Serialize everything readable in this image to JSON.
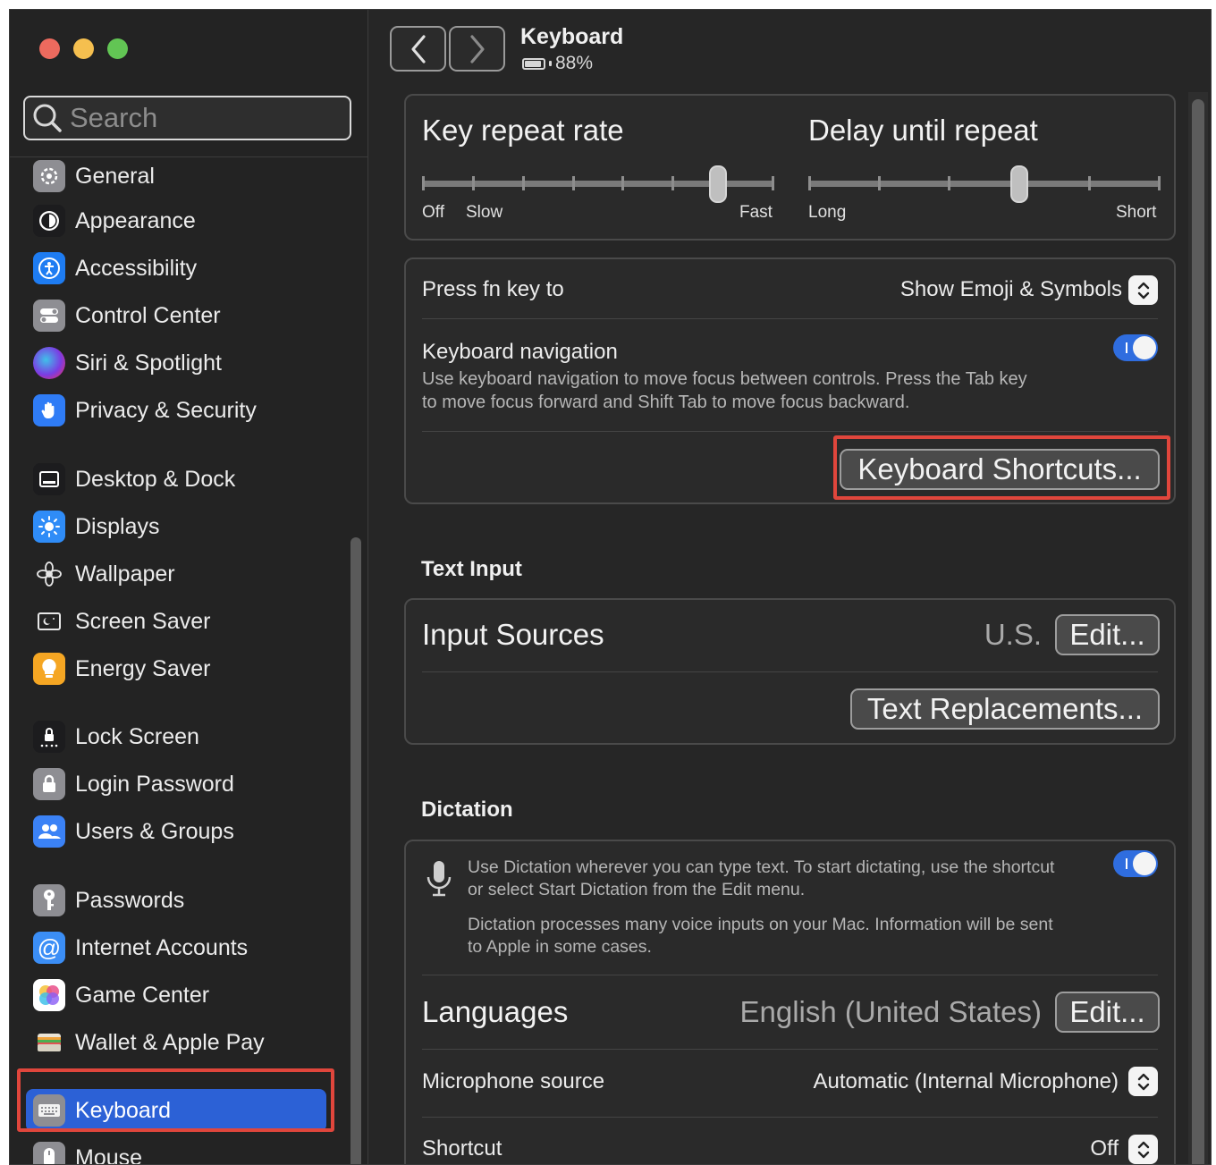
{
  "window": {
    "title": "Keyboard",
    "battery_percent": "88%",
    "battery_level": 0.88
  },
  "search": {
    "placeholder": "Search"
  },
  "sidebar": {
    "items": [
      {
        "label": "General",
        "icon": "gear-icon",
        "color": "#8e8e93"
      },
      {
        "label": "Appearance",
        "icon": "appearance-icon",
        "color": "#1c1c1e"
      },
      {
        "label": "Accessibility",
        "icon": "accessibility-icon",
        "color": "#1e7cf2"
      },
      {
        "label": "Control Center",
        "icon": "control-center-icon",
        "color": "#8e8e93"
      },
      {
        "label": "Siri & Spotlight",
        "icon": "siri-icon",
        "color": "#6c3ce0"
      },
      {
        "label": "Privacy & Security",
        "icon": "hand-icon",
        "color": "#2f7cf6"
      },
      {
        "label": "Desktop & Dock",
        "icon": "dock-icon",
        "color": "#1c1c1e"
      },
      {
        "label": "Displays",
        "icon": "sun-icon",
        "color": "#2f8cf7"
      },
      {
        "label": "Wallpaper",
        "icon": "flower-icon",
        "color": "#232323"
      },
      {
        "label": "Screen Saver",
        "icon": "screen-saver-icon",
        "color": "#232323"
      },
      {
        "label": "Energy Saver",
        "icon": "lightbulb-icon",
        "color": "#f5a623"
      },
      {
        "label": "Lock Screen",
        "icon": "lock-screen-icon",
        "color": "#1c1c1e"
      },
      {
        "label": "Login Password",
        "icon": "lock-icon",
        "color": "#8e8e93"
      },
      {
        "label": "Users & Groups",
        "icon": "users-icon",
        "color": "#3b82f6"
      },
      {
        "label": "Passwords",
        "icon": "key-icon",
        "color": "#8e8e93"
      },
      {
        "label": "Internet Accounts",
        "icon": "at-icon",
        "color": "#3b8ef6"
      },
      {
        "label": "Game Center",
        "icon": "game-center-icon",
        "color": "#ffffff"
      },
      {
        "label": "Wallet & Apple Pay",
        "icon": "wallet-icon",
        "color": "#2a2a2a"
      },
      {
        "label": "Keyboard",
        "icon": "keyboard-icon",
        "color": "#8e8e93",
        "selected": true
      },
      {
        "label": "Mouse",
        "icon": "mouse-icon",
        "color": "#8e8e93"
      }
    ]
  },
  "key_repeat": {
    "title": "Key repeat rate",
    "label_off": "Off",
    "label_slow": "Slow",
    "label_fast": "Fast",
    "ticks": 8,
    "value_fraction": 0.84
  },
  "delay_repeat": {
    "title": "Delay until repeat",
    "label_long": "Long",
    "label_short": "Short",
    "ticks": 6,
    "value_fraction": 0.6
  },
  "fn_key": {
    "label": "Press fn key to",
    "value": "Show Emoji & Symbols"
  },
  "keyboard_navigation": {
    "label": "Keyboard navigation",
    "description_line1": "Use keyboard navigation to move focus between controls. Press the Tab key",
    "description_line2": "to move focus forward and Shift Tab to move focus backward.",
    "enabled": true
  },
  "keyboard_shortcuts_button": "Keyboard Shortcuts...",
  "text_input": {
    "heading": "Text Input",
    "input_sources_label": "Input Sources",
    "input_sources_value": "U.S.",
    "edit_button": "Edit...",
    "text_replacements_button": "Text Replacements..."
  },
  "dictation": {
    "heading": "Dictation",
    "desc_line1": "Use Dictation wherever you can type text. To start dictating, use the shortcut",
    "desc_line2": "or select Start Dictation from the Edit menu.",
    "privacy_line1": "Dictation processes many voice inputs on your Mac. Information will be sent",
    "privacy_line2": "to Apple in some cases.",
    "enabled": true,
    "languages_label": "Languages",
    "languages_value": "English (United States)",
    "edit_button": "Edit...",
    "mic_label": "Microphone source",
    "mic_value": "Automatic (Internal Microphone)",
    "shortcut_label": "Shortcut",
    "shortcut_value": "Off"
  },
  "colors": {
    "accent": "#2c61d6",
    "toggle_on": "#2f6ddf",
    "highlight": "#e0463c"
  }
}
